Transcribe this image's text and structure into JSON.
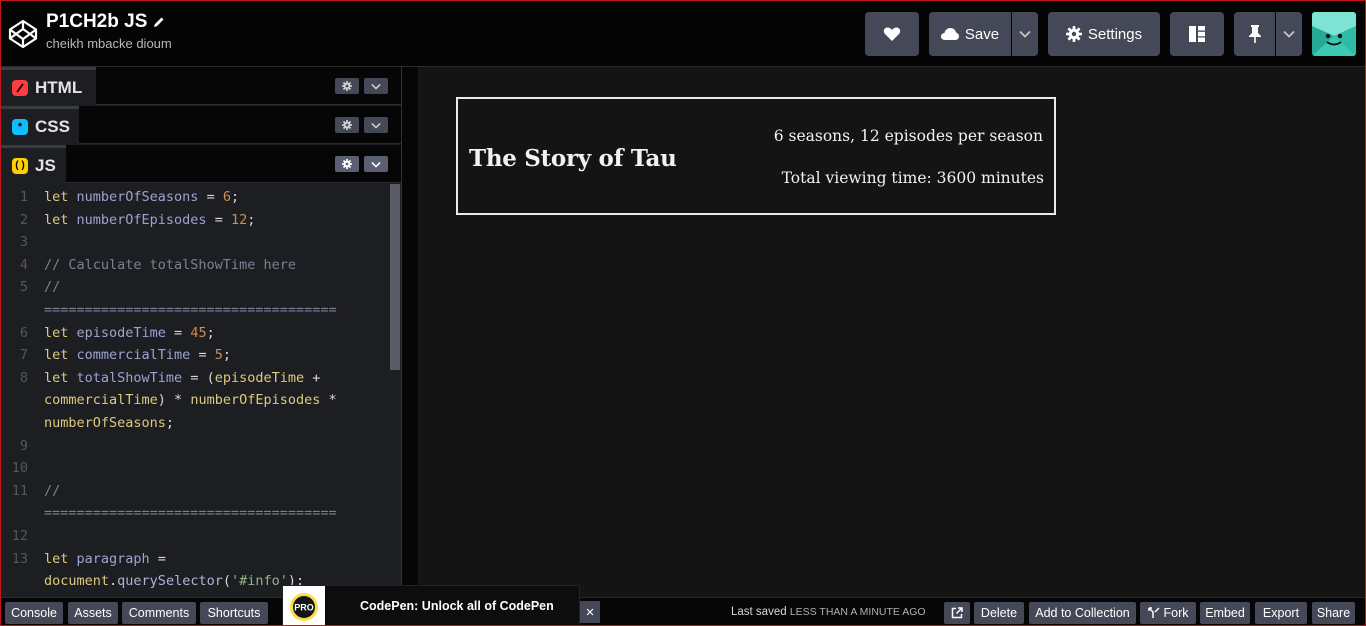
{
  "header": {
    "pen_title": "P1CH2b JS",
    "author": "cheikh mbacke dioum",
    "save_label": "Save",
    "settings_label": "Settings"
  },
  "editors": {
    "html_label": "HTML",
    "css_label": "CSS",
    "js_label": "JS"
  },
  "code": {
    "lines": [
      {
        "num": "1",
        "parts": [
          [
            "k",
            "let "
          ],
          [
            "v",
            "numberOfSeasons"
          ],
          [
            "p",
            " = "
          ],
          [
            "n",
            "6"
          ],
          [
            "p",
            ";"
          ]
        ]
      },
      {
        "num": "2",
        "parts": [
          [
            "k",
            "let "
          ],
          [
            "v",
            "numberOfEpisodes"
          ],
          [
            "p",
            " = "
          ],
          [
            "n",
            "12"
          ],
          [
            "p",
            ";"
          ]
        ]
      },
      {
        "num": "3",
        "parts": []
      },
      {
        "num": "4",
        "parts": [
          [
            "c",
            "// Calculate totalShowTime here"
          ]
        ]
      },
      {
        "num": "5",
        "parts": [
          [
            "c",
            "//"
          ]
        ]
      },
      {
        "num": "",
        "parts": [
          [
            "c",
            "===================================="
          ]
        ]
      },
      {
        "num": "6",
        "parts": [
          [
            "k",
            "let "
          ],
          [
            "v",
            "episodeTime"
          ],
          [
            "p",
            " = "
          ],
          [
            "n",
            "45"
          ],
          [
            "p",
            ";"
          ]
        ]
      },
      {
        "num": "7",
        "parts": [
          [
            "k",
            "let "
          ],
          [
            "v",
            "commercialTime"
          ],
          [
            "p",
            " = "
          ],
          [
            "n",
            "5"
          ],
          [
            "p",
            ";"
          ]
        ]
      },
      {
        "num": "8",
        "parts": [
          [
            "k",
            "let "
          ],
          [
            "v",
            "totalShowTime"
          ],
          [
            "p",
            " = ("
          ],
          [
            "k",
            "episodeTime"
          ],
          [
            "p",
            " +"
          ]
        ]
      },
      {
        "num": "",
        "parts": [
          [
            "k",
            "commercialTime"
          ],
          [
            "p",
            ") * "
          ],
          [
            "k",
            "numberOfEpisodes"
          ],
          [
            "p",
            " *"
          ]
        ]
      },
      {
        "num": "",
        "parts": [
          [
            "k",
            "numberOfSeasons"
          ],
          [
            "p",
            ";"
          ]
        ]
      },
      {
        "num": "9",
        "parts": []
      },
      {
        "num": "10",
        "parts": []
      },
      {
        "num": "11",
        "parts": [
          [
            "c",
            "//"
          ]
        ]
      },
      {
        "num": "",
        "parts": [
          [
            "c",
            "===================================="
          ]
        ]
      },
      {
        "num": "12",
        "parts": []
      },
      {
        "num": "13",
        "parts": [
          [
            "k",
            "let "
          ],
          [
            "v",
            "paragraph"
          ],
          [
            "p",
            " ="
          ]
        ]
      },
      {
        "num": "",
        "parts": [
          [
            "k",
            "document"
          ],
          [
            "p",
            "."
          ],
          [
            "f",
            "querySelector"
          ],
          [
            "p",
            "("
          ],
          [
            "s",
            "'#info'"
          ],
          [
            "p",
            ");"
          ]
        ]
      }
    ]
  },
  "preview": {
    "title": "The Story of Tau",
    "line1": "6 seasons, 12 episodes per season",
    "line2": "Total viewing time: 3600 minutes"
  },
  "footer": {
    "console": "Console",
    "assets": "Assets",
    "comments": "Comments",
    "shortcuts": "Shortcuts",
    "last_saved_prefix": "Last saved",
    "last_saved_when": "LESS THAN A MINUTE AGO",
    "delete": "Delete",
    "add_to_collection": "Add to Collection",
    "fork": "Fork",
    "embed": "Embed",
    "export": "Export",
    "share": "Share"
  },
  "promo": {
    "badge": "PRO",
    "text": "CodePen: Unlock all of CodePen",
    "close": "×"
  },
  "colors": {
    "button_bg": "#444857",
    "html_icon": "#ff3c41",
    "css_icon": "#0ebeff",
    "js_icon": "#fcd000"
  }
}
